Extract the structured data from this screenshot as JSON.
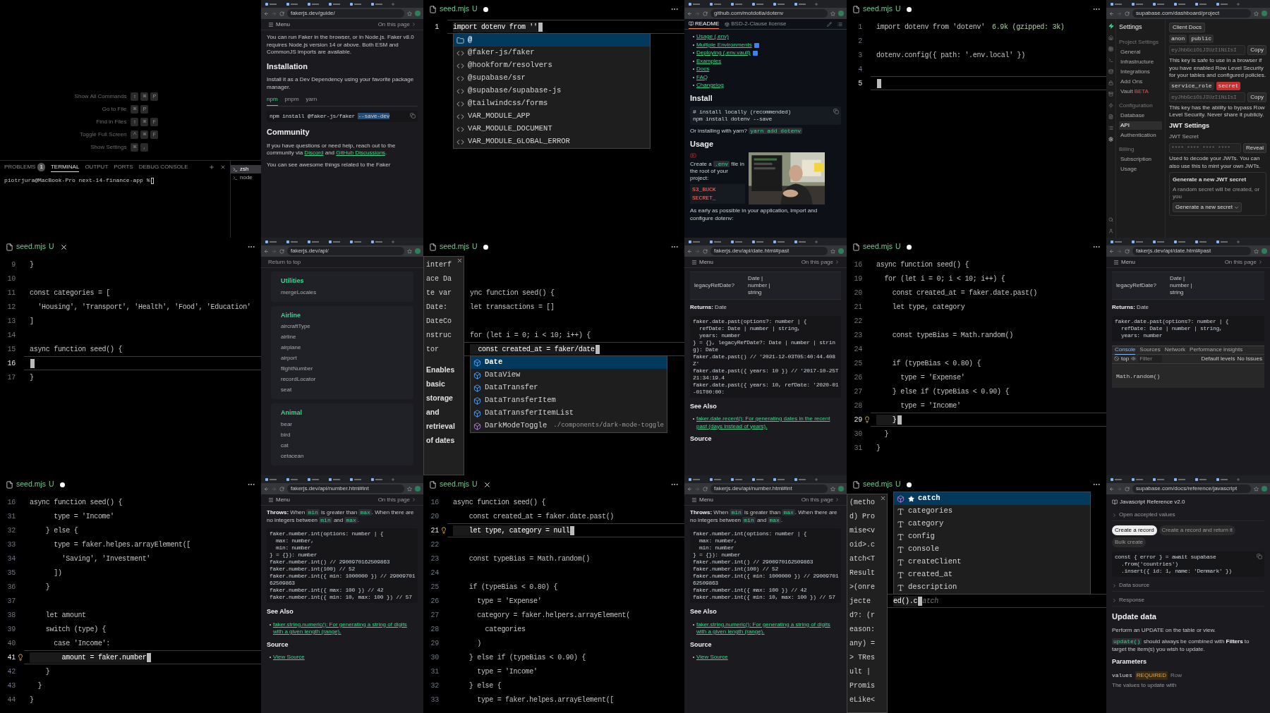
{
  "panels": [
    {
      "kind": "terminal",
      "shortcuts": [
        {
          "label": "Show All Commands",
          "keys": [
            "⇧",
            "⌘",
            "P"
          ]
        },
        {
          "label": "Go to File",
          "keys": [
            "⌘",
            "P"
          ]
        },
        {
          "label": "Find in Files",
          "keys": [
            "⇧",
            "⌘",
            "F"
          ]
        },
        {
          "label": "Toggle Full Screen",
          "keys": [
            "^",
            "⌘",
            "F"
          ]
        },
        {
          "label": "Show Settings",
          "keys": [
            "⌘",
            ","
          ]
        }
      ],
      "panel_tabs": [
        {
          "label": "PROBLEMS",
          "badge": "1",
          "selected": false
        },
        {
          "label": "TERMINAL",
          "selected": true
        },
        {
          "label": "OUTPUT",
          "selected": false
        },
        {
          "label": "PORTS",
          "selected": false
        },
        {
          "label": "DEBUG CONSOLE",
          "selected": false
        }
      ],
      "prompt": "piotrjura@MacBook-Pro next-14-finance-app %",
      "sessions": [
        {
          "label": "zsh",
          "selected": true
        },
        {
          "label": "node",
          "selected": false
        }
      ]
    },
    {
      "kind": "browser",
      "url": "fakerjs.dev/guide/",
      "nav": {
        "menu": "Menu",
        "toc": "On this page"
      },
      "blocks": [
        {
          "kind": "para",
          "parts": [
            {
              "kind": "text",
              "text": "You can run Faker in the browser, or in Node.js. Faker v8.0 requires Node.js version 14 or above. Both ESM and CommonJS imports are available."
            }
          ]
        },
        {
          "kind": "heading",
          "text": "Installation"
        },
        {
          "kind": "para",
          "parts": [
            {
              "kind": "text",
              "text": "Install it as a Dev Dependency using your favorite package manager."
            }
          ]
        },
        {
          "kind": "tabs",
          "items": [
            {
              "label": "npm",
              "selected": true
            },
            {
              "label": "pnpm",
              "selected": false
            },
            {
              "label": "yarn",
              "selected": false
            }
          ]
        },
        {
          "kind": "code",
          "lines": [
            "npm install @faker-js/faker"
          ],
          "selection": "--save-dev",
          "copy": true
        },
        {
          "kind": "heading",
          "text": "Community"
        },
        {
          "kind": "para",
          "parts": [
            {
              "kind": "text",
              "text": "If you have questions or need help, reach out to the community via "
            },
            {
              "kind": "link",
              "text": "Discord"
            },
            {
              "kind": "text",
              "text": " and "
            },
            {
              "kind": "link",
              "text": "GitHub Discussions"
            },
            {
              "kind": "text",
              "text": "."
            }
          ]
        },
        {
          "kind": "para",
          "parts": [
            {
              "kind": "text",
              "text": "You can see awesome things related to the Faker"
            }
          ]
        }
      ]
    },
    {
      "kind": "editor",
      "tab": {
        "name": "seed.mjs",
        "status": "U",
        "dirty": true
      },
      "lines": [
        {
          "kind": "code",
          "n": "1",
          "text": "import dotenv from ''",
          "current": true,
          "suggest": {
            "items": [
              {
                "label": "@",
                "kind": "folder",
                "selected": true
              },
              {
                "label": "@faker-js/faker",
                "kind": "module",
                "selected": false
              },
              {
                "label": "@hookform/resolvers",
                "kind": "module",
                "selected": false
              },
              {
                "label": "@supabase/ssr",
                "kind": "module",
                "selected": false
              },
              {
                "label": "@supabase/supabase-js",
                "kind": "module",
                "selected": false
              },
              {
                "label": "@tailwindcss/forms",
                "kind": "module",
                "selected": false
              },
              {
                "label": "VAR_MODULE_APP",
                "kind": "module",
                "selected": false
              },
              {
                "label": "VAR_MODULE_DOCUMENT",
                "kind": "module",
                "selected": false
              },
              {
                "label": "VAR_MODULE_GLOBAL_ERROR",
                "kind": "module",
                "selected": false
              }
            ]
          }
        }
      ]
    },
    {
      "kind": "github",
      "url": "github.com/motdotla/dotenv",
      "header": [
        {
          "label": "README",
          "selected": true
        },
        {
          "label": "BSD-2-Clause license",
          "selected": false
        }
      ],
      "blocks": [
        {
          "kind": "links",
          "items": [
            {
              "text": "Usage (.env)"
            },
            {
              "text": "Multiple Environments",
              "new": true
            },
            {
              "text": "Deploying (.env.vault)",
              "new": true
            },
            {
              "text": "Examples"
            },
            {
              "text": "Docs"
            },
            {
              "text": "FAQ"
            },
            {
              "text": "Changelog"
            }
          ]
        },
        {
          "kind": "heading",
          "text": "Install"
        },
        {
          "kind": "code",
          "lines": [
            "# install locally (recommended)",
            "npm install dotenv --save"
          ],
          "copy": true
        },
        {
          "kind": "para",
          "parts": [
            {
              "kind": "text",
              "text": "Or installing with yarn? "
            },
            {
              "kind": "code",
              "text": "yarn add dotenv"
            }
          ]
        },
        {
          "kind": "heading",
          "text": "Usage"
        },
        {
          "kind": "media",
          "parts": [
            {
              "kind": "text",
              "text": "Create a "
            },
            {
              "kind": "code",
              "text": ".env"
            },
            {
              "kind": "text",
              "text": " file in the root of your project:"
            }
          ],
          "code": [
            "S3_BUCK",
            "SECRET_"
          ]
        },
        {
          "kind": "para",
          "parts": [
            {
              "kind": "text",
              "text": "As early as possible in your application, import and configure dotenv:"
            }
          ]
        }
      ]
    },
    {
      "kind": "editor",
      "tab": {
        "name": "seed.mjs",
        "status": "U",
        "dirty": true
      },
      "lines": [
        {
          "kind": "code",
          "n": "1",
          "text": "import dotenv from 'dotenv'",
          "hint": "6.9k (gzipped: 3k)",
          "current": false
        },
        {
          "kind": "code",
          "n": "2",
          "current": false
        },
        {
          "kind": "code",
          "n": "3",
          "text": "dotenv.config({ path: '.env.local' })",
          "current": false
        },
        {
          "kind": "code",
          "n": "4",
          "current": false
        },
        {
          "kind": "code",
          "n": "5",
          "current": true
        }
      ]
    },
    {
      "kind": "dashboard",
      "url": "supabase.com/dashboard/project",
      "title": "Settings",
      "nav": [
        {
          "heading": "Project Settings",
          "items": [
            {
              "label": "General",
              "selected": false
            },
            {
              "label": "Infrastructure",
              "selected": false
            },
            {
              "label": "Integrations",
              "selected": false
            },
            {
              "label": "Add Ons",
              "selected": false
            },
            {
              "label": "Vault",
              "badge": "BETA",
              "selected": false
            }
          ]
        },
        {
          "heading": "Configuration",
          "items": [
            {
              "label": "Database",
              "selected": false
            },
            {
              "label": "API",
              "selected": true
            },
            {
              "label": "Authentication",
              "selected": false
            }
          ]
        },
        {
          "heading": "Billing",
          "items": [
            {
              "label": "Subscription",
              "selected": false
            },
            {
              "label": "Usage",
              "selected": false
            }
          ]
        }
      ],
      "blocks": [
        {
          "kind": "button",
          "text": "Client Docs"
        },
        {
          "kind": "tags",
          "items": [
            {
              "text": "anon",
              "color": "#2e2e2e"
            },
            {
              "text": "public",
              "color": "#2e2e2e"
            }
          ]
        },
        {
          "kind": "keyfield",
          "value": "eyJhbGciOiJIUzI1NiIsI",
          "button": "Copy"
        },
        {
          "kind": "para",
          "parts": [
            {
              "kind": "text",
              "text": "This key is safe to use in a browser if you have enabled Row Level Security for your tables and configured policies."
            }
          ]
        },
        {
          "kind": "tags",
          "items": [
            {
              "text": "service_role",
              "color": "#2e2e2e"
            },
            {
              "text": "secret",
              "color": "#c53030"
            }
          ]
        },
        {
          "kind": "keyfield",
          "value": "eyJhbGciOiJIUzI1NiIsI",
          "button": "Copy"
        },
        {
          "kind": "para",
          "parts": [
            {
              "kind": "text",
              "text": "This key has the ability to bypass Row Level Security. Never share it publicly."
            }
          ]
        },
        {
          "kind": "subheading",
          "text": "JWT Settings"
        },
        {
          "kind": "label",
          "text": "JWT Secret"
        },
        {
          "kind": "keyfield",
          "value": "**** **** **** ****",
          "button": "Reveal"
        },
        {
          "kind": "para",
          "parts": [
            {
              "kind": "text",
              "text": "Used to decode your JWTs. You can also use this to mint your own JWTs."
            }
          ]
        },
        {
          "kind": "callout",
          "title": "Generate a new JWT secret",
          "text": "A random secret will be created, or you",
          "button": "Generate a new secret"
        }
      ]
    },
    {
      "kind": "editor",
      "tab": {
        "name": "seed.mjs",
        "status": "U",
        "dirty": false
      },
      "lines": [
        {
          "kind": "code",
          "n": "9",
          "text": "}",
          "current": false
        },
        {
          "kind": "code",
          "n": "10",
          "current": false
        },
        {
          "kind": "code",
          "n": "11",
          "text": "const categories = [",
          "current": false
        },
        {
          "kind": "code",
          "n": "12",
          "text": "  'Housing', 'Transport', 'Health', 'Food', 'Education'",
          "current": false
        },
        {
          "kind": "code",
          "n": "13",
          "text": "]",
          "current": false
        },
        {
          "kind": "code",
          "n": "14",
          "current": false
        },
        {
          "kind": "code",
          "n": "15",
          "text": "async function seed() {",
          "current": false
        },
        {
          "kind": "code",
          "n": "16",
          "current": true
        },
        {
          "kind": "code",
          "n": "17",
          "text": "}",
          "current": false
        }
      ]
    },
    {
      "kind": "browser",
      "url": "fakerjs.dev/api/",
      "nav": {
        "top": "Return to top"
      },
      "blocks": [
        {
          "kind": "card",
          "title": "Utilities",
          "items": [
            "mergeLocales"
          ]
        },
        {
          "kind": "card",
          "title": "Airline",
          "items": [
            "aircraftType",
            "airline",
            "airplane",
            "airport",
            "flightNumber",
            "recordLocator",
            "seat"
          ]
        },
        {
          "kind": "card",
          "title": "Animal",
          "items": [
            "bear",
            "bird",
            "cat",
            "cetacean"
          ]
        }
      ]
    },
    {
      "kind": "editor",
      "tab": {
        "name": "seed.mjs",
        "status": "U",
        "dirty": true
      },
      "hover": {
        "signature": [
          "interf",
          "ace Da",
          "te var",
          "Date:",
          "DateCo",
          "nstruc",
          "tor"
        ],
        "text": "Enables basic storage and retrieval of dates"
      },
      "lines": [
        {
          "kind": "blank"
        },
        {
          "kind": "blank"
        },
        {
          "kind": "code",
          "text": "ync function seed() {",
          "current": false
        },
        {
          "kind": "code",
          "text": "let transactions = []",
          "current": false
        },
        {
          "kind": "blank"
        },
        {
          "kind": "code",
          "text": "for (let i = 0; i < 10; i++) {",
          "current": false
        },
        {
          "kind": "code",
          "text": "  const created_at = faker/date",
          "current": true,
          "suggest": {
            "items": [
              {
                "label": "Date",
                "kind": "class",
                "selected": true
              },
              {
                "label": "DataView",
                "kind": "class",
                "selected": false
              },
              {
                "label": "DataTransfer",
                "kind": "class",
                "selected": false
              },
              {
                "label": "DataTransferItem",
                "kind": "class",
                "selected": false
              },
              {
                "label": "DataTransferItemList",
                "kind": "class",
                "selected": false
              },
              {
                "label": "DarkModeToggle",
                "kind": "method",
                "detail": "./components/dark-mode-toggle",
                "selected": false
              }
            ]
          }
        }
      ]
    },
    {
      "kind": "browser",
      "url": "fakerjs.dev/api/date.html#past",
      "nav": {
        "menu": "Menu",
        "toc": "On this page"
      },
      "blocks": [
        {
          "kind": "table",
          "cells": [
            "legacyRefDate?",
            "Date | number | string"
          ]
        },
        {
          "kind": "para",
          "parts": [
            {
              "kind": "bold",
              "text": "Returns:"
            },
            {
              "kind": "text",
              "text": " Date"
            }
          ]
        },
        {
          "kind": "code",
          "lines": [
            "faker.date.past(options?: number | {",
            "  refDate: Date | number | string,",
            "  years: number",
            "} = {}, legacyRefDate?: Date | number | string): Date",
            "faker.date.past() // '2021-12-03T05:40:44.408Z'",
            "faker.date.past({ years: 10 }) // '2017-10-25T21:34:19.4",
            "faker.date.past({ years: 10, refDate: '2020-01-01T00:00:"
          ]
        },
        {
          "kind": "subheading",
          "text": "See Also"
        },
        {
          "kind": "links",
          "items": [
            {
              "text": "faker.date.recent(): For generating dates in the recent past (days instead of years)."
            }
          ]
        },
        {
          "kind": "subheading",
          "text": "Source"
        }
      ]
    },
    {
      "kind": "editor",
      "tab": {
        "name": "seed.mjs",
        "status": "U",
        "dirty": true
      },
      "lines": [
        {
          "kind": "code",
          "n": "16",
          "text": "async function seed() {",
          "current": false
        },
        {
          "kind": "code",
          "n": "19",
          "text": "  for (let i = 0; i < 10; i++) {",
          "current": false
        },
        {
          "kind": "code",
          "n": "20",
          "text": "    const created_at = faker.date.past()",
          "current": false
        },
        {
          "kind": "code",
          "n": "21",
          "text": "    let type, category",
          "current": false
        },
        {
          "kind": "code",
          "n": "22",
          "current": false
        },
        {
          "kind": "code",
          "n": "23",
          "text": "    const typeBias = Math.random()",
          "current": false
        },
        {
          "kind": "code",
          "n": "24",
          "current": false
        },
        {
          "kind": "code",
          "n": "25",
          "text": "    if (typeBias < 0.80) {",
          "current": false
        },
        {
          "kind": "code",
          "n": "26",
          "text": "      type = 'Expense'",
          "current": false
        },
        {
          "kind": "code",
          "n": "27",
          "text": "    } else if (typeBias < 0.90) {",
          "current": false
        },
        {
          "kind": "code",
          "n": "28",
          "text": "      type = 'Income'",
          "current": false
        },
        {
          "kind": "code",
          "n": "29",
          "text": "    }",
          "current": true,
          "bulb": true
        },
        {
          "kind": "code",
          "n": "30",
          "text": "  }",
          "current": false
        },
        {
          "kind": "code",
          "n": "31",
          "text": "}",
          "current": false
        }
      ]
    },
    {
      "kind": "browser",
      "url": "fakerjs.dev/api/date.html#past",
      "nav": {
        "menu": "Menu",
        "toc": "On this page"
      },
      "blocks": [
        {
          "kind": "table",
          "cells": [
            "legacyRefDate?",
            "Date | number | string"
          ]
        },
        {
          "kind": "para",
          "parts": [
            {
              "kind": "bold",
              "text": "Returns:"
            },
            {
              "kind": "text",
              "text": " Date"
            }
          ]
        },
        {
          "kind": "code",
          "lines": [
            "faker.date.past(options?: number | {",
            "  refDate: Date | number | string,",
            "  years: number"
          ]
        },
        {
          "kind": "devtools",
          "tabs": [
            {
              "label": "Console",
              "selected": true
            },
            {
              "label": "Sources",
              "selected": false
            },
            {
              "label": "Network",
              "selected": false
            },
            {
              "label": "Performance insights",
              "selected": false
            }
          ],
          "context": "top",
          "placeholder": "Filter",
          "levels": "Default levels",
          "issues": "No Issues",
          "input": "Math.random()"
        }
      ]
    },
    {
      "kind": "editor",
      "tab": {
        "name": "seed.mjs",
        "status": "U",
        "dirty": true
      },
      "lines": [
        {
          "kind": "code",
          "n": "16",
          "text": "async function seed() {",
          "current": false
        },
        {
          "kind": "code",
          "n": "31",
          "text": "      type = 'Income'",
          "current": false
        },
        {
          "kind": "code",
          "n": "32",
          "text": "    } else {",
          "current": false
        },
        {
          "kind": "code",
          "n": "33",
          "text": "      type = faker.helpes.arrayElement([",
          "current": false
        },
        {
          "kind": "code",
          "n": "34",
          "text": "        'Saving', 'Investment'",
          "current": false
        },
        {
          "kind": "code",
          "n": "35",
          "text": "      ])",
          "current": false
        },
        {
          "kind": "code",
          "n": "36",
          "text": "    }",
          "current": false
        },
        {
          "kind": "code",
          "n": "37",
          "current": false
        },
        {
          "kind": "code",
          "n": "38",
          "text": "    let amount",
          "current": false
        },
        {
          "kind": "code",
          "n": "39",
          "text": "    switch (type) {",
          "current": false
        },
        {
          "kind": "code",
          "n": "40",
          "text": "      case 'Income':",
          "current": false
        },
        {
          "kind": "code",
          "n": "41",
          "text": "        amount = faker.number",
          "current": true,
          "bulb": true
        },
        {
          "kind": "code",
          "n": "42",
          "text": "    }",
          "current": false
        },
        {
          "kind": "code",
          "n": "43",
          "text": "  }",
          "current": false
        },
        {
          "kind": "code",
          "n": "44",
          "text": "}",
          "current": false
        }
      ]
    },
    {
      "kind": "browser",
      "url": "fakerjs.dev/api/number.html#int",
      "nav": {
        "menu": "Menu",
        "toc": "On this page"
      },
      "blocks": [
        {
          "kind": "para",
          "parts": [
            {
              "kind": "bold",
              "text": "Throws:"
            },
            {
              "kind": "text",
              "text": " When "
            },
            {
              "kind": "code",
              "text": "min"
            },
            {
              "kind": "text",
              "text": " is greater than "
            },
            {
              "kind": "code",
              "text": "max"
            },
            {
              "kind": "text",
              "text": ". When there are no integers between "
            },
            {
              "kind": "code",
              "text": "min"
            },
            {
              "kind": "text",
              "text": " and "
            },
            {
              "kind": "code",
              "text": "max"
            },
            {
              "kind": "text",
              "text": "."
            }
          ]
        },
        {
          "kind": "code",
          "lines": [
            "faker.number.int(options: number | {",
            "  max: number,",
            "  min: number",
            "} = {}): number",
            "faker.number.int() // 2900970162509863",
            "faker.number.int(100) // 52",
            "faker.number.int({ min: 1000000 }) // 2900970162509863",
            "faker.number.int({ max: 100 }) // 42",
            "faker.number.int({ min: 10, max: 100 }) // 57"
          ]
        },
        {
          "kind": "subheading",
          "text": "See Also"
        },
        {
          "kind": "links",
          "items": [
            {
              "text": "faker.string.numeric(): For generating a string of digits with a given length (range)."
            }
          ]
        },
        {
          "kind": "subheading",
          "text": "Source"
        },
        {
          "kind": "links",
          "items": [
            {
              "text": "View Source"
            }
          ]
        }
      ]
    },
    {
      "kind": "editor",
      "tab": {
        "name": "seed.mjs",
        "status": "U",
        "dirty": false
      },
      "lines": [
        {
          "kind": "code",
          "n": "16",
          "text": "async function seed() {",
          "current": false
        },
        {
          "kind": "code",
          "n": "20",
          "text": "    const created_at = faker.date.past()",
          "current": false
        },
        {
          "kind": "code",
          "n": "21",
          "text": "    let type, category = null",
          "current": true,
          "bulb": true
        },
        {
          "kind": "code",
          "n": "22",
          "current": false
        },
        {
          "kind": "code",
          "n": "23",
          "text": "    const typeBias = Math.random()",
          "current": false
        },
        {
          "kind": "code",
          "n": "24",
          "current": false
        },
        {
          "kind": "code",
          "n": "25",
          "text": "    if (typeBias < 0.80) {",
          "current": false
        },
        {
          "kind": "code",
          "n": "26",
          "text": "      type = 'Expense'",
          "current": false
        },
        {
          "kind": "code",
          "n": "27",
          "text": "      category = faker.helpers.arrayElement(",
          "current": false
        },
        {
          "kind": "code",
          "n": "28",
          "text": "        categories",
          "current": false
        },
        {
          "kind": "code",
          "n": "29",
          "text": "      )",
          "current": false
        },
        {
          "kind": "code",
          "n": "30",
          "text": "    } else if (typeBias < 0.90) {",
          "current": false
        },
        {
          "kind": "code",
          "n": "31",
          "text": "      type = 'Income'",
          "current": false
        },
        {
          "kind": "code",
          "n": "32",
          "text": "    } else {",
          "current": false
        },
        {
          "kind": "code",
          "n": "33",
          "text": "      type = faker.helpes.arrayElement([",
          "current": false
        }
      ]
    },
    {
      "kind": "browser",
      "url": "fakerjs.dev/api/number.html#int",
      "nav": {
        "menu": "Menu",
        "toc": "On this page"
      },
      "blocks": [
        {
          "kind": "para",
          "parts": [
            {
              "kind": "bold",
              "text": "Throws:"
            },
            {
              "kind": "text",
              "text": " When "
            },
            {
              "kind": "code",
              "text": "min"
            },
            {
              "kind": "text",
              "text": " is greater than "
            },
            {
              "kind": "code",
              "text": "max"
            },
            {
              "kind": "text",
              "text": ". When there are no integers between "
            },
            {
              "kind": "code",
              "text": "min"
            },
            {
              "kind": "text",
              "text": " and "
            },
            {
              "kind": "code",
              "text": "max"
            },
            {
              "kind": "text",
              "text": "."
            }
          ]
        },
        {
          "kind": "code",
          "lines": [
            "faker.number.int(options: number | {",
            "  max: number,",
            "  min: number",
            "} = {}): number",
            "faker.number.int() // 2900970162509863",
            "faker.number.int(100) // 52",
            "faker.number.int({ min: 1000000 }) // 2900970162509863",
            "faker.number.int({ max: 100 }) // 42",
            "faker.number.int({ min: 10, max: 100 }) // 57"
          ]
        },
        {
          "kind": "subheading",
          "text": "See Also"
        },
        {
          "kind": "links",
          "items": [
            {
              "text": "faker.string.numeric(): For generating a string of digits with a given length (range)."
            }
          ]
        },
        {
          "kind": "subheading",
          "text": "Source"
        },
        {
          "kind": "links",
          "items": [
            {
              "text": "View Source"
            }
          ]
        }
      ]
    },
    {
      "kind": "editor",
      "tab": {
        "name": "seed.mjs",
        "status": "U",
        "dirty": true
      },
      "hover": {
        "signature": [
          "(metho",
          "d) Pro",
          "mise<v",
          "oid>.c",
          "atch<T",
          "Result",
          ">(onre",
          "jecte",
          "d?: (r",
          "eason:",
          "any) =",
          "> TRes",
          "ult |",
          "Promis",
          "eLike<"
        ]
      },
      "lines": [
        {
          "kind": "blank"
        },
        {
          "kind": "blank"
        },
        {
          "kind": "blank"
        },
        {
          "kind": "blank"
        },
        {
          "kind": "blank"
        },
        {
          "kind": "blank"
        },
        {
          "kind": "blank"
        },
        {
          "kind": "code",
          "text": "ed().c",
          "ghost": "atch",
          "current": true,
          "suggest": {
            "items": [
              {
                "label": "catch",
                "kind": "method",
                "starred": true,
                "selected": true
              },
              {
                "label": "categories",
                "kind": "word",
                "selected": false
              },
              {
                "label": "category",
                "kind": "word",
                "selected": false
              },
              {
                "label": "config",
                "kind": "word",
                "selected": false
              },
              {
                "label": "console",
                "kind": "word",
                "selected": false
              },
              {
                "label": "createClient",
                "kind": "word",
                "selected": false
              },
              {
                "label": "created_at",
                "kind": "word",
                "selected": false
              },
              {
                "label": "description",
                "kind": "word",
                "selected": false
              }
            ]
          }
        }
      ]
    },
    {
      "kind": "browser",
      "url": "supabase.com/docs/reference/javascript",
      "blocks": [
        {
          "kind": "ref",
          "text": "Javascript Reference v2.0"
        },
        {
          "kind": "disclosure",
          "text": "Open accepted values"
        },
        {
          "kind": "pills",
          "items": [
            {
              "label": "Create a record",
              "selected": true
            },
            {
              "label": "Create a record and return it",
              "selected": false
            },
            {
              "label": "Bulk create",
              "selected": false
            }
          ]
        },
        {
          "kind": "code",
          "lines": [
            "const { error } = await supabase",
            "  .from('countries')",
            "  .insert({ id: 1, name: 'Denmark' })"
          ],
          "copy": true
        },
        {
          "kind": "disclosure",
          "text": "Data source"
        },
        {
          "kind": "disclosure",
          "text": "Response"
        },
        {
          "kind": "heading",
          "text": "Update data"
        },
        {
          "kind": "para",
          "parts": [
            {
              "kind": "text",
              "text": "Perform an UPDATE on the table or view."
            }
          ]
        },
        {
          "kind": "para",
          "parts": [
            {
              "kind": "code",
              "text": "update()"
            },
            {
              "kind": "text",
              "text": " should always be combined with "
            },
            {
              "kind": "bold",
              "text": "Filters"
            },
            {
              "kind": "text",
              "text": " to target the item(s) you wish to update."
            }
          ]
        },
        {
          "kind": "subheading",
          "text": "Parameters"
        },
        {
          "kind": "param",
          "name": "values",
          "badge": "REQUIRED",
          "type": "Row",
          "desc": "The values to update with"
        }
      ]
    }
  ]
}
